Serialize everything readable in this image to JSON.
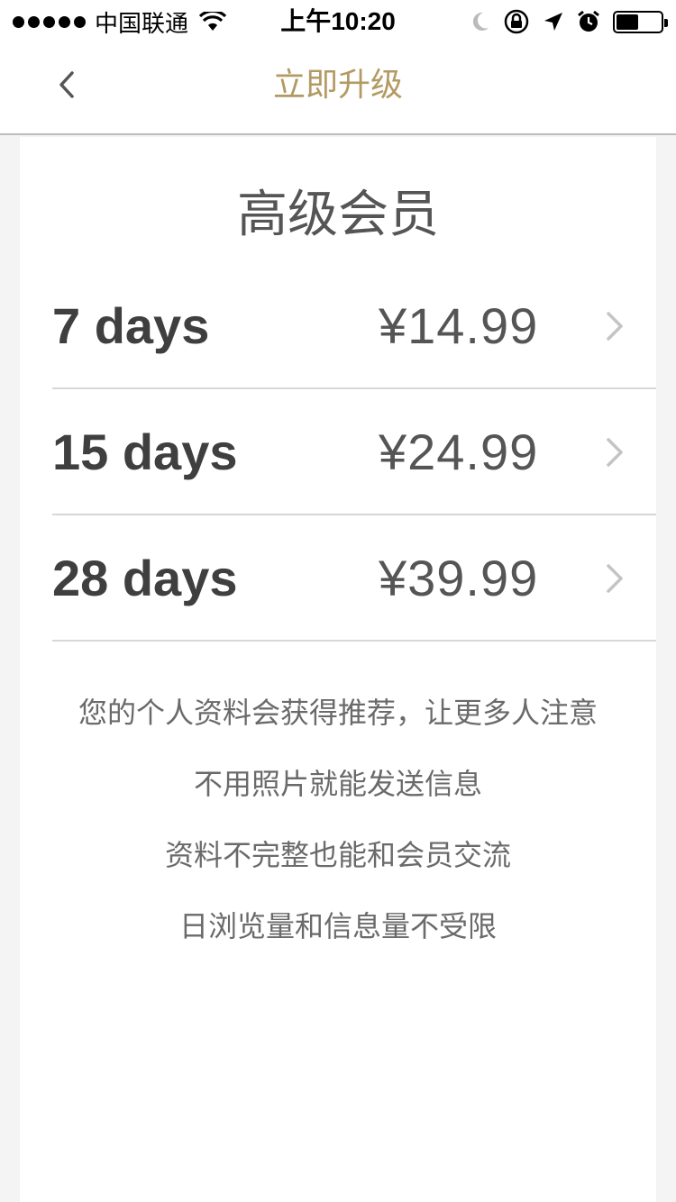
{
  "status_bar": {
    "carrier": "中国联通",
    "time": "上午10:20",
    "battery_level": 0.5
  },
  "nav": {
    "title": "立即升级",
    "back_icon": "chevron-left-icon"
  },
  "colors": {
    "accent": "#b39a63",
    "text_dark": "#3f3f3f",
    "text_muted": "#6a6a6a"
  },
  "main": {
    "title": "高级会员",
    "plans": [
      {
        "duration": "7 days",
        "price": "¥14.99"
      },
      {
        "duration": "15 days",
        "price": "¥24.99"
      },
      {
        "duration": "28 days",
        "price": "¥39.99"
      }
    ],
    "features": [
      "您的个人资料会获得推荐，让更多人注意",
      "不用照片就能发送信息",
      "资料不完整也能和会员交流",
      "日浏览量和信息量不受限"
    ]
  }
}
